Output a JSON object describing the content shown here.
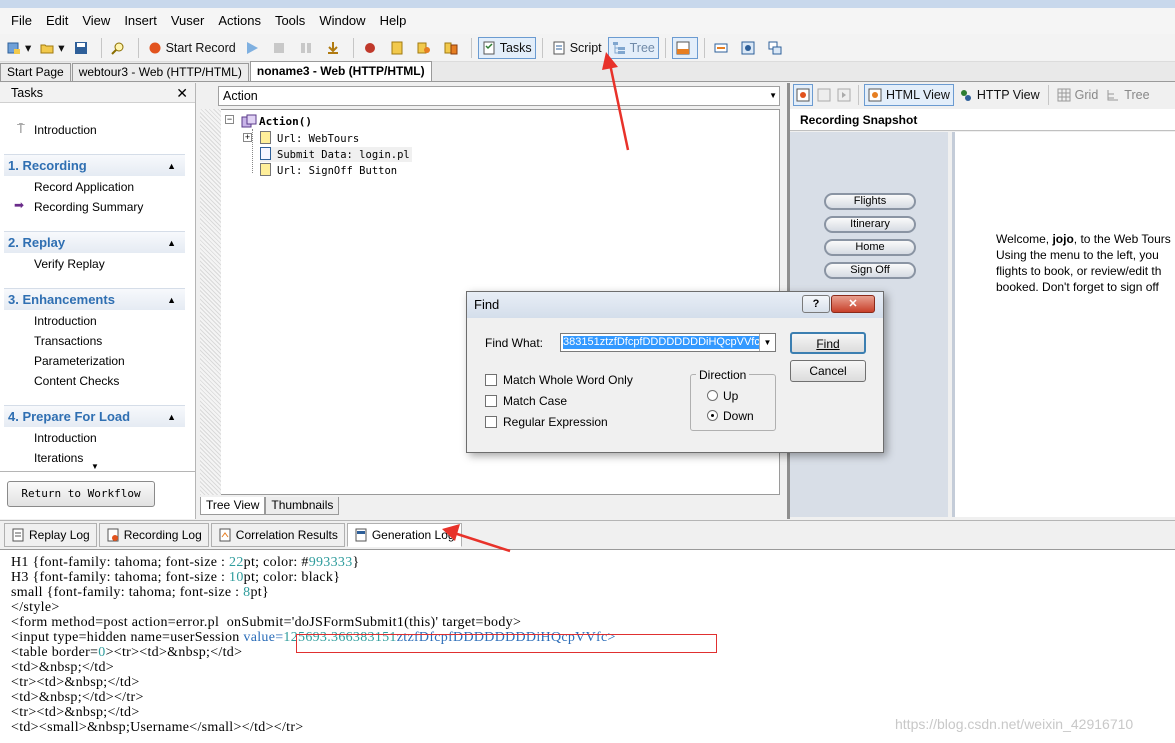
{
  "menu": {
    "items": [
      "File",
      "Edit",
      "View",
      "Insert",
      "Vuser",
      "Actions",
      "Tools",
      "Window",
      "Help"
    ]
  },
  "toolbar": {
    "start_record": "Start Record",
    "tasks": "Tasks",
    "script": "Script",
    "tree": "Tree"
  },
  "doc_tabs": [
    "Start Page",
    "webtour3 - Web (HTTP/HTML)",
    "noname3 - Web (HTTP/HTML)"
  ],
  "tasks": {
    "header": "Tasks",
    "intro": "Introduction",
    "sections": [
      {
        "title": "1. Recording",
        "items": [
          "Record Application",
          "Recording Summary"
        ]
      },
      {
        "title": "2. Replay",
        "items": [
          "Verify Replay"
        ]
      },
      {
        "title": "3. Enhancements",
        "items": [
          "Introduction",
          "Transactions",
          "Parameterization",
          "Content Checks"
        ]
      },
      {
        "title": "4. Prepare For Load",
        "items": [
          "Introduction",
          "Iterations"
        ]
      }
    ],
    "return_button": "Return to Workflow"
  },
  "tree": {
    "action_combo": "Action",
    "nodes": [
      "Action()",
      "Url: WebTours",
      "Submit Data: login.pl",
      "Url: SignOff Button"
    ],
    "tabs": [
      "Tree View",
      "Thumbnails"
    ]
  },
  "snapshot": {
    "views": [
      "HTML View",
      "HTTP View",
      "Grid",
      "Tree"
    ],
    "title": "Recording Snapshot",
    "nav_buttons": [
      "Flights",
      "Itinerary",
      "Home",
      "Sign Off"
    ],
    "welcome_pre": "Welcome, ",
    "welcome_user": "jojo",
    "welcome_post": ", to the Web Tours",
    "welcome_lines": [
      "Using the menu to the left, you",
      "flights to book, or review/edit th",
      "booked. Don't forget to sign off"
    ]
  },
  "log": {
    "tabs": [
      "Replay Log",
      "Recording Log",
      "Correlation Results",
      "Generation Log"
    ],
    "lines": {
      "l1a": "H1 {font-family: tahoma; font-size : ",
      "l1b": "22",
      "l1c": "pt; color: #",
      "l1d": "993333",
      "l1e": "}",
      "l2a": "H3 {font-family: tahoma; font-size : ",
      "l2b": "10",
      "l2c": "pt; color: black}",
      "l3a": "small {font-family: tahoma; font-size : ",
      "l3b": "8",
      "l3c": "pt}",
      "l4": "</style>",
      "l5": "<form method=post action=error.pl  onSubmit='doJSFormSubmit1(this)' target=body>",
      "l6a": "<input type=hidden name=userSession ",
      "l6b": "value=",
      "l6c": "125693.366383151",
      "l6d": "ztzfDfcpfDDDDDDDDiHQcpVVfc>",
      "l7a": "<table border=",
      "l7b": "0",
      "l7c": "><tr><td>&nbsp;</td>",
      "l8": "<td>&nbsp;</td>",
      "l9": "<tr><td>&nbsp;</td>",
      "l10": "<td>&nbsp;</td></tr>",
      "l11": "<tr><td>&nbsp;</td>",
      "l12": "<td><small>&nbsp;Username</small></td></tr>"
    }
  },
  "find": {
    "title": "Find",
    "find_what_label": "Find What:",
    "find_what_value": "383151ztzfDfcpfDDDDDDDDiHQcpVVfc",
    "find_button": "Find",
    "cancel_button": "Cancel",
    "options": [
      "Match Whole Word Only",
      "Match Case",
      "Regular Expression"
    ],
    "direction_label": "Direction",
    "up": "Up",
    "down": "Down",
    "selected_direction": "Down"
  },
  "watermark": "https://blog.csdn.net/weixin_42916710"
}
